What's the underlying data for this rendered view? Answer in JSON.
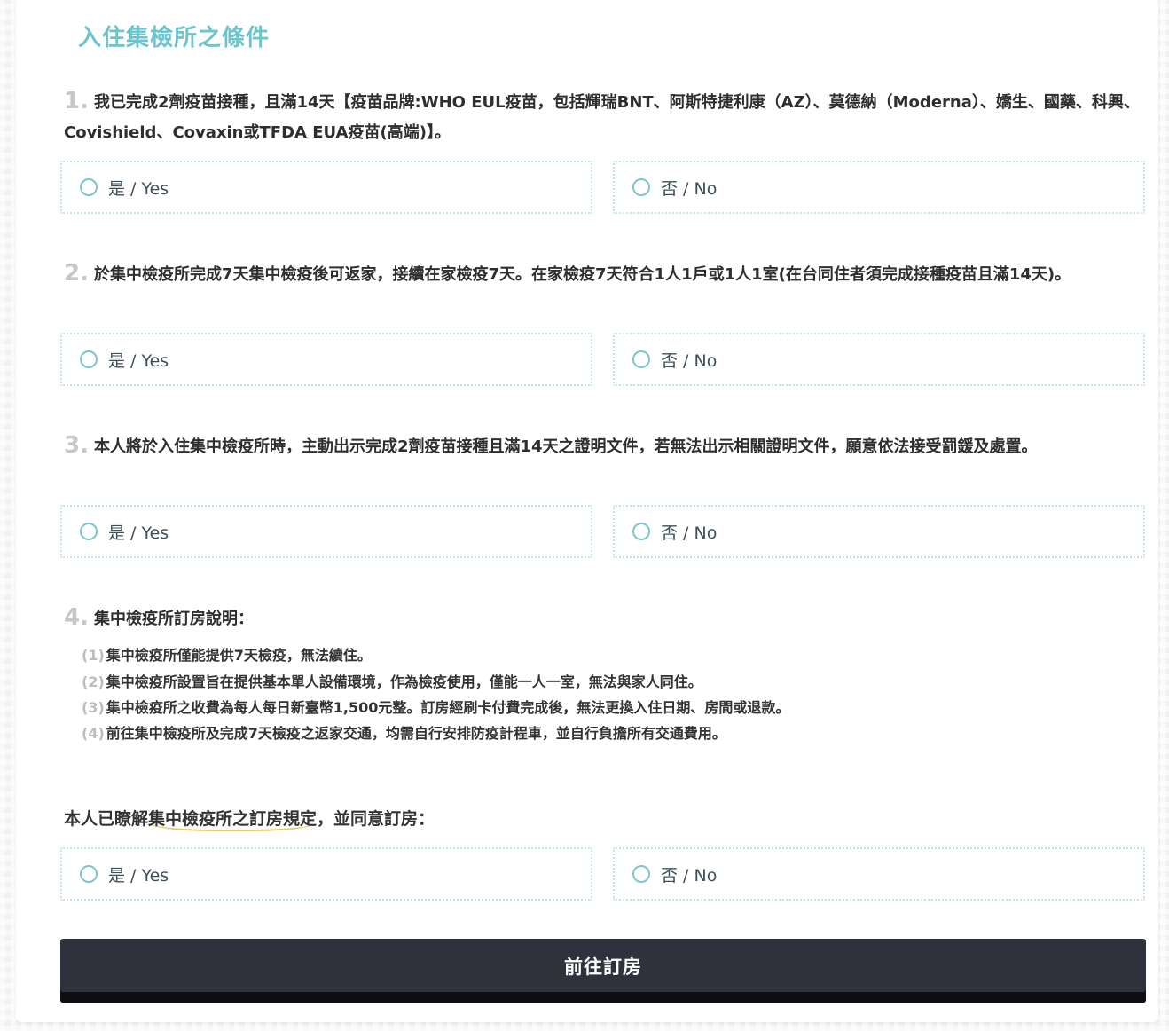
{
  "page": {
    "title": "入住集檢所之條件"
  },
  "questions": [
    {
      "number": "1.",
      "text": "我已完成2劑疫苗接種，且滿14天【疫苗品牌:WHO EUL疫苗，包括輝瑞BNT、阿斯特捷利康（AZ）、莫德納（Moderna）、嬌生、國藥、科興、Covishield、Covaxin或TFDA EUA疫苗(高端)】。",
      "yes_label": "是 / Yes",
      "no_label": "否 / No"
    },
    {
      "number": "2.",
      "text": "於集中檢疫所完成7天集中檢疫後可返家，接續在家檢疫7天。在家檢疫7天符合1人1戶或1人1室(在台同住者須完成接種疫苗且滿14天)。",
      "yes_label": "是 / Yes",
      "no_label": "否 / No"
    },
    {
      "number": "3.",
      "text": "本人將於入住集中檢疫所時，主動出示完成2劑疫苗接種且滿14天之證明文件，若無法出示相關證明文件，願意依法接受罰鍰及處置。",
      "yes_label": "是 / Yes",
      "no_label": "否 / No"
    },
    {
      "number": "4.",
      "text": "集中檢疫所訂房說明："
    }
  ],
  "notes": [
    {
      "number": "(1)",
      "text": "集中檢疫所僅能提供7天檢疫，無法續住。"
    },
    {
      "number": "(2)",
      "text": "集中檢疫所設置旨在提供基本單人設備環境，作為檢疫使用，僅能一人一室，無法與家人同住。"
    },
    {
      "number": "(3)",
      "text": "集中檢疫所之收費為每人每日新臺幣1,500元整。訂房經刷卡付費完成後，無法更換入住日期、房間或退款。"
    },
    {
      "number": "(4)",
      "text": "前往集中檢疫所及完成7天檢疫之返家交通，均需自行安排防疫計程車，並自行負擔所有交通費用。"
    }
  ],
  "agreement": {
    "prefix": "本人已瞭解",
    "link_text": "集中檢疫所之訂房規定",
    "suffix": "，並同意訂房：",
    "yes_label": "是 / Yes",
    "no_label": "否 / No"
  },
  "submit_label": "前往訂房",
  "colors": {
    "title": "#6cc5cd",
    "radio_border": "#7cc6cf",
    "option_border": "#c5e5ea",
    "link_underline": "#e8c95b",
    "button_bg": "#2f323c"
  }
}
